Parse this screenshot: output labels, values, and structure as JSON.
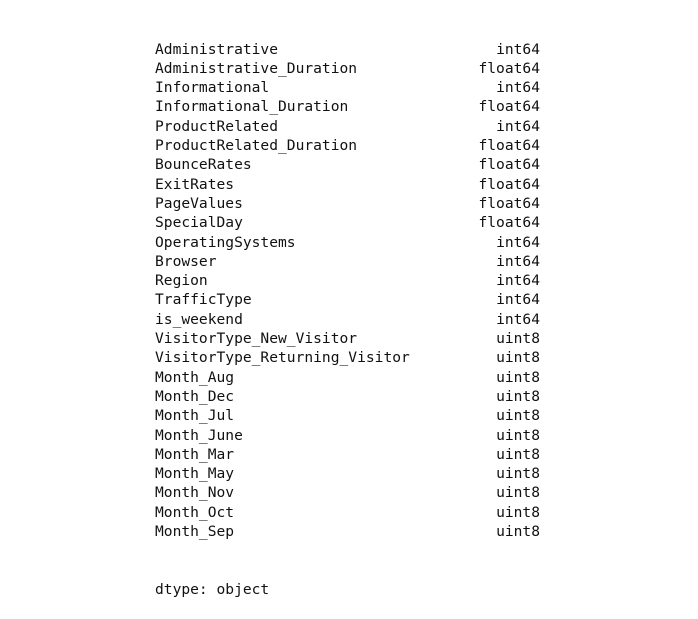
{
  "series": {
    "rows": [
      {
        "name": "Administrative",
        "dtype": "int64"
      },
      {
        "name": "Administrative_Duration",
        "dtype": "float64"
      },
      {
        "name": "Informational",
        "dtype": "int64"
      },
      {
        "name": "Informational_Duration",
        "dtype": "float64"
      },
      {
        "name": "ProductRelated",
        "dtype": "int64"
      },
      {
        "name": "ProductRelated_Duration",
        "dtype": "float64"
      },
      {
        "name": "BounceRates",
        "dtype": "float64"
      },
      {
        "name": "ExitRates",
        "dtype": "float64"
      },
      {
        "name": "PageValues",
        "dtype": "float64"
      },
      {
        "name": "SpecialDay",
        "dtype": "float64"
      },
      {
        "name": "OperatingSystems",
        "dtype": "int64"
      },
      {
        "name": "Browser",
        "dtype": "int64"
      },
      {
        "name": "Region",
        "dtype": "int64"
      },
      {
        "name": "TrafficType",
        "dtype": "int64"
      },
      {
        "name": "is_weekend",
        "dtype": "int64"
      },
      {
        "name": "VisitorType_New_Visitor",
        "dtype": "uint8"
      },
      {
        "name": "VisitorType_Returning_Visitor",
        "dtype": "uint8"
      },
      {
        "name": "Month_Aug",
        "dtype": "uint8"
      },
      {
        "name": "Month_Dec",
        "dtype": "uint8"
      },
      {
        "name": "Month_Jul",
        "dtype": "uint8"
      },
      {
        "name": "Month_June",
        "dtype": "uint8"
      },
      {
        "name": "Month_Mar",
        "dtype": "uint8"
      },
      {
        "name": "Month_May",
        "dtype": "uint8"
      },
      {
        "name": "Month_Nov",
        "dtype": "uint8"
      },
      {
        "name": "Month_Oct",
        "dtype": "uint8"
      },
      {
        "name": "Month_Sep",
        "dtype": "uint8"
      }
    ],
    "footer": "dtype: object"
  }
}
